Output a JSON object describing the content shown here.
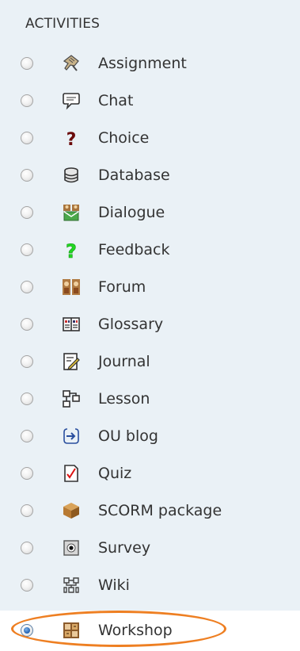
{
  "section": {
    "heading": "ACTIVITIES"
  },
  "activities": [
    {
      "label": "Assignment",
      "icon": "assignment-icon",
      "selected": false
    },
    {
      "label": "Chat",
      "icon": "chat-icon",
      "selected": false
    },
    {
      "label": "Choice",
      "icon": "choice-icon",
      "selected": false
    },
    {
      "label": "Database",
      "icon": "database-icon",
      "selected": false
    },
    {
      "label": "Dialogue",
      "icon": "dialogue-icon",
      "selected": false
    },
    {
      "label": "Feedback",
      "icon": "feedback-icon",
      "selected": false
    },
    {
      "label": "Forum",
      "icon": "forum-icon",
      "selected": false
    },
    {
      "label": "Glossary",
      "icon": "glossary-icon",
      "selected": false
    },
    {
      "label": "Journal",
      "icon": "journal-icon",
      "selected": false
    },
    {
      "label": "Lesson",
      "icon": "lesson-icon",
      "selected": false
    },
    {
      "label": "OU blog",
      "icon": "ou-blog-icon",
      "selected": false
    },
    {
      "label": "Quiz",
      "icon": "quiz-icon",
      "selected": false
    },
    {
      "label": "SCORM package",
      "icon": "scorm-package-icon",
      "selected": false
    },
    {
      "label": "Survey",
      "icon": "survey-icon",
      "selected": false
    },
    {
      "label": "Wiki",
      "icon": "wiki-icon",
      "selected": false
    },
    {
      "label": "Workshop",
      "icon": "workshop-icon",
      "selected": true
    }
  ],
  "colors": {
    "panel": "#eaf1f6",
    "text": "#333333",
    "highlight": "#ee7f22",
    "selected_radio": "#1f5fb0"
  }
}
